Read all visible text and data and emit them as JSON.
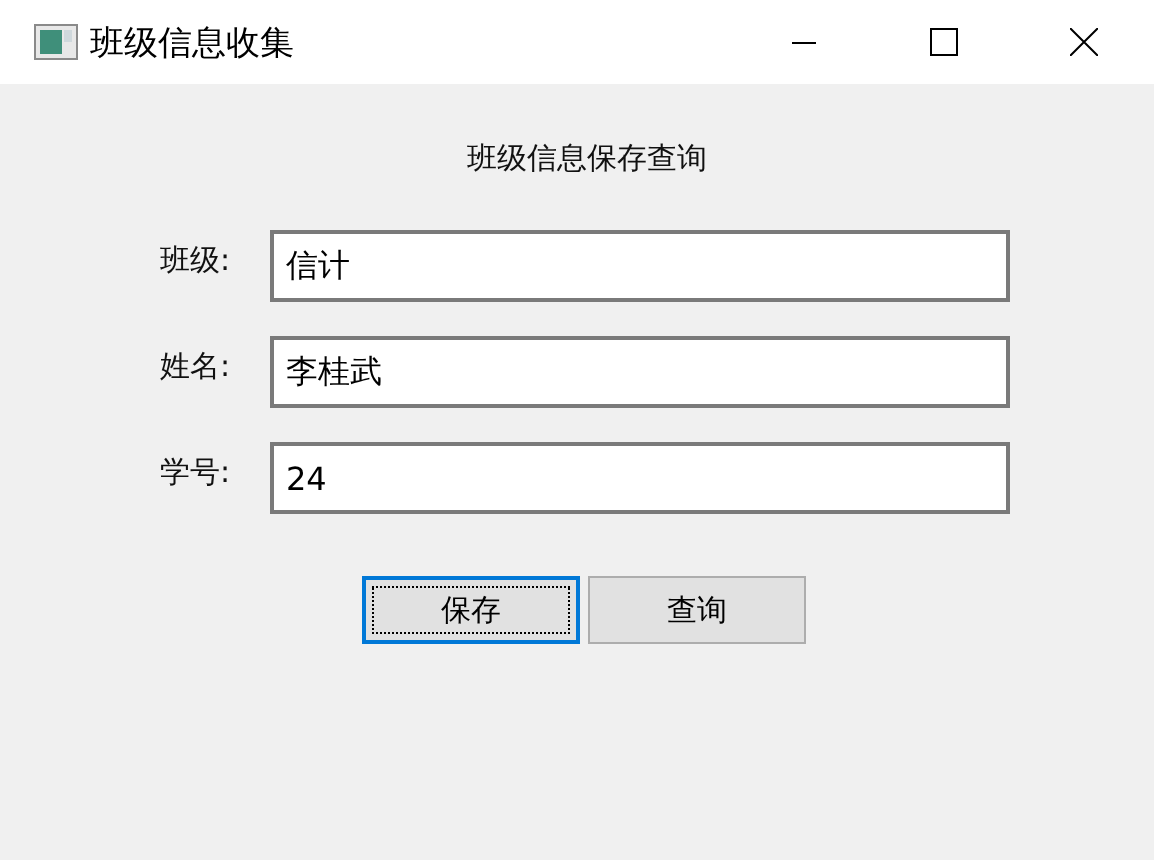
{
  "window": {
    "title": "班级信息收集"
  },
  "heading": "班级信息保存查询",
  "fields": [
    {
      "label": "班级:",
      "value": "信计"
    },
    {
      "label": "姓名:",
      "value": "李桂武"
    },
    {
      "label": "学号:",
      "value": "24"
    }
  ],
  "buttons": [
    {
      "label": "保存",
      "focused": true
    },
    {
      "label": "查询",
      "focused": false
    }
  ]
}
